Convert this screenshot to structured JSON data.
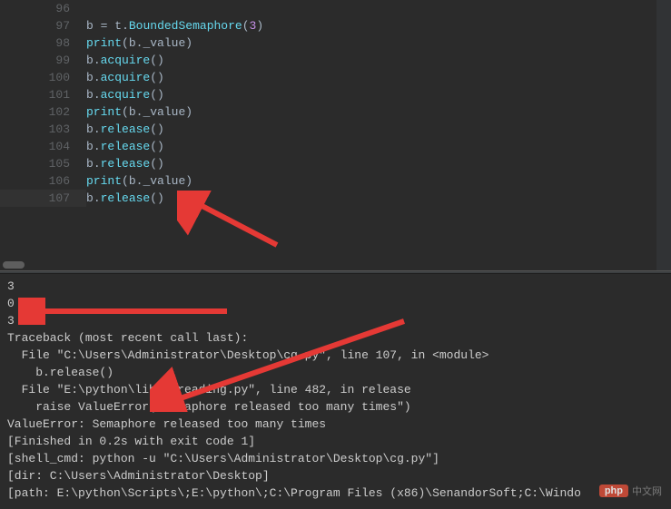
{
  "editor": {
    "lines": [
      {
        "num": "96",
        "tokens": []
      },
      {
        "num": "97",
        "tokens": [
          {
            "t": "b",
            "c": "tk-var"
          },
          {
            "t": " ",
            "c": ""
          },
          {
            "t": "=",
            "c": "tk-op"
          },
          {
            "t": " ",
            "c": ""
          },
          {
            "t": "t",
            "c": "tk-var"
          },
          {
            "t": ".",
            "c": "tk-op"
          },
          {
            "t": "BoundedSemaphore",
            "c": "tk-func"
          },
          {
            "t": "(",
            "c": "tk-paren"
          },
          {
            "t": "3",
            "c": "tk-num"
          },
          {
            "t": ")",
            "c": "tk-paren"
          }
        ]
      },
      {
        "num": "98",
        "tokens": [
          {
            "t": "print",
            "c": "tk-builtin"
          },
          {
            "t": "(",
            "c": "tk-paren"
          },
          {
            "t": "b",
            "c": "tk-var"
          },
          {
            "t": ".",
            "c": "tk-op"
          },
          {
            "t": "_value",
            "c": "tk-var"
          },
          {
            "t": ")",
            "c": "tk-paren"
          }
        ]
      },
      {
        "num": "99",
        "tokens": [
          {
            "t": "b",
            "c": "tk-var"
          },
          {
            "t": ".",
            "c": "tk-op"
          },
          {
            "t": "acquire",
            "c": "tk-method"
          },
          {
            "t": "()",
            "c": "tk-paren"
          }
        ]
      },
      {
        "num": "100",
        "tokens": [
          {
            "t": "b",
            "c": "tk-var"
          },
          {
            "t": ".",
            "c": "tk-op"
          },
          {
            "t": "acquire",
            "c": "tk-method"
          },
          {
            "t": "()",
            "c": "tk-paren"
          }
        ]
      },
      {
        "num": "101",
        "tokens": [
          {
            "t": "b",
            "c": "tk-var"
          },
          {
            "t": ".",
            "c": "tk-op"
          },
          {
            "t": "acquire",
            "c": "tk-method"
          },
          {
            "t": "()",
            "c": "tk-paren"
          }
        ]
      },
      {
        "num": "102",
        "tokens": [
          {
            "t": "print",
            "c": "tk-builtin"
          },
          {
            "t": "(",
            "c": "tk-paren"
          },
          {
            "t": "b",
            "c": "tk-var"
          },
          {
            "t": ".",
            "c": "tk-op"
          },
          {
            "t": "_value",
            "c": "tk-var"
          },
          {
            "t": ")",
            "c": "tk-paren"
          }
        ]
      },
      {
        "num": "103",
        "tokens": [
          {
            "t": "b",
            "c": "tk-var"
          },
          {
            "t": ".",
            "c": "tk-op"
          },
          {
            "t": "release",
            "c": "tk-method"
          },
          {
            "t": "()",
            "c": "tk-paren"
          }
        ]
      },
      {
        "num": "104",
        "tokens": [
          {
            "t": "b",
            "c": "tk-var"
          },
          {
            "t": ".",
            "c": "tk-op"
          },
          {
            "t": "release",
            "c": "tk-method"
          },
          {
            "t": "()",
            "c": "tk-paren"
          }
        ]
      },
      {
        "num": "105",
        "tokens": [
          {
            "t": "b",
            "c": "tk-var"
          },
          {
            "t": ".",
            "c": "tk-op"
          },
          {
            "t": "release",
            "c": "tk-method"
          },
          {
            "t": "()",
            "c": "tk-paren"
          }
        ]
      },
      {
        "num": "106",
        "tokens": [
          {
            "t": "print",
            "c": "tk-builtin"
          },
          {
            "t": "(",
            "c": "tk-paren"
          },
          {
            "t": "b",
            "c": "tk-var"
          },
          {
            "t": ".",
            "c": "tk-op"
          },
          {
            "t": "_value",
            "c": "tk-var"
          },
          {
            "t": ")",
            "c": "tk-paren"
          }
        ]
      },
      {
        "num": "107",
        "tokens": [
          {
            "t": "b",
            "c": "tk-var"
          },
          {
            "t": ".",
            "c": "tk-op"
          },
          {
            "t": "release",
            "c": "tk-method"
          },
          {
            "t": "()",
            "c": "tk-paren"
          }
        ],
        "highlighted": true
      }
    ]
  },
  "terminal": {
    "lines": [
      "3",
      "0",
      "3",
      "Traceback (most recent call last):",
      "  File \"C:\\Users\\Administrator\\Desktop\\cg.py\", line 107, in <module>",
      "    b.release()",
      "  File \"E:\\python\\lib\\threading.py\", line 482, in release",
      "    raise ValueError(\"Semaphore released too many times\")",
      "ValueError: Semaphore released too many times",
      "[Finished in 0.2s with exit code 1]",
      "[shell_cmd: python -u \"C:\\Users\\Administrator\\Desktop\\cg.py\"]",
      "[dir: C:\\Users\\Administrator\\Desktop]",
      "[path: E:\\python\\Scripts\\;E:\\python\\;C:\\Program Files (x86)\\SenandorSoft;C:\\Windo"
    ]
  },
  "watermark": {
    "badge": "php",
    "text": "中文网"
  }
}
